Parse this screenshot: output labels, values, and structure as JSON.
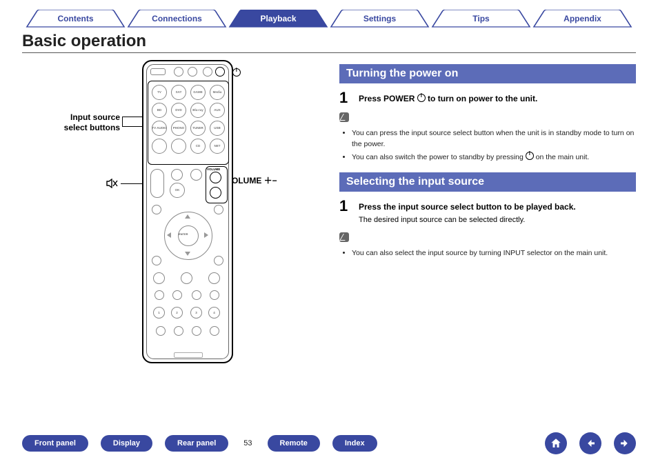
{
  "tabs": [
    "Contents",
    "Connections",
    "Playback",
    "Settings",
    "Tips",
    "Appendix"
  ],
  "active_tab_index": 2,
  "title": "Basic operation",
  "annotations": {
    "power": "⏻",
    "input_source": "Input source\nselect buttons",
    "mute": "🔇",
    "volume": "VOLUME ＋−"
  },
  "sections": [
    {
      "header": "Turning the power on",
      "step_num": "1",
      "step_text": "Press POWER ⏻ to turn on power to the unit.",
      "notes": [
        "You can press the input source select button when the unit is in standby mode to turn on the power.",
        "You can also switch the power to standby by pressing ⏻ on the main unit."
      ]
    },
    {
      "header": "Selecting the input source",
      "step_num": "1",
      "step_text": "Press the input source select button to be played back.",
      "step_sub": "The desired input source can be selected directly.",
      "notes": [
        "You can also select the input source by turning INPUT selector on the main unit."
      ]
    }
  ],
  "footer_links": [
    "Front panel",
    "Display",
    "Rear panel"
  ],
  "page_number": "53",
  "footer_links_right": [
    "Remote",
    "Index"
  ],
  "remote_buttons": {
    "row1": [
      "",
      "",
      "",
      ""
    ],
    "grid": [
      "TV",
      "SAT",
      "GAME",
      "Media",
      "BD",
      "DVD",
      "Blu-ray",
      "AUX",
      "TV AUDIO",
      "PHONO",
      "TUNER",
      "USB",
      "",
      "CD",
      "",
      "NET"
    ],
    "ok": "OK",
    "volume": "VOLUME",
    "enter": "ENTER"
  }
}
